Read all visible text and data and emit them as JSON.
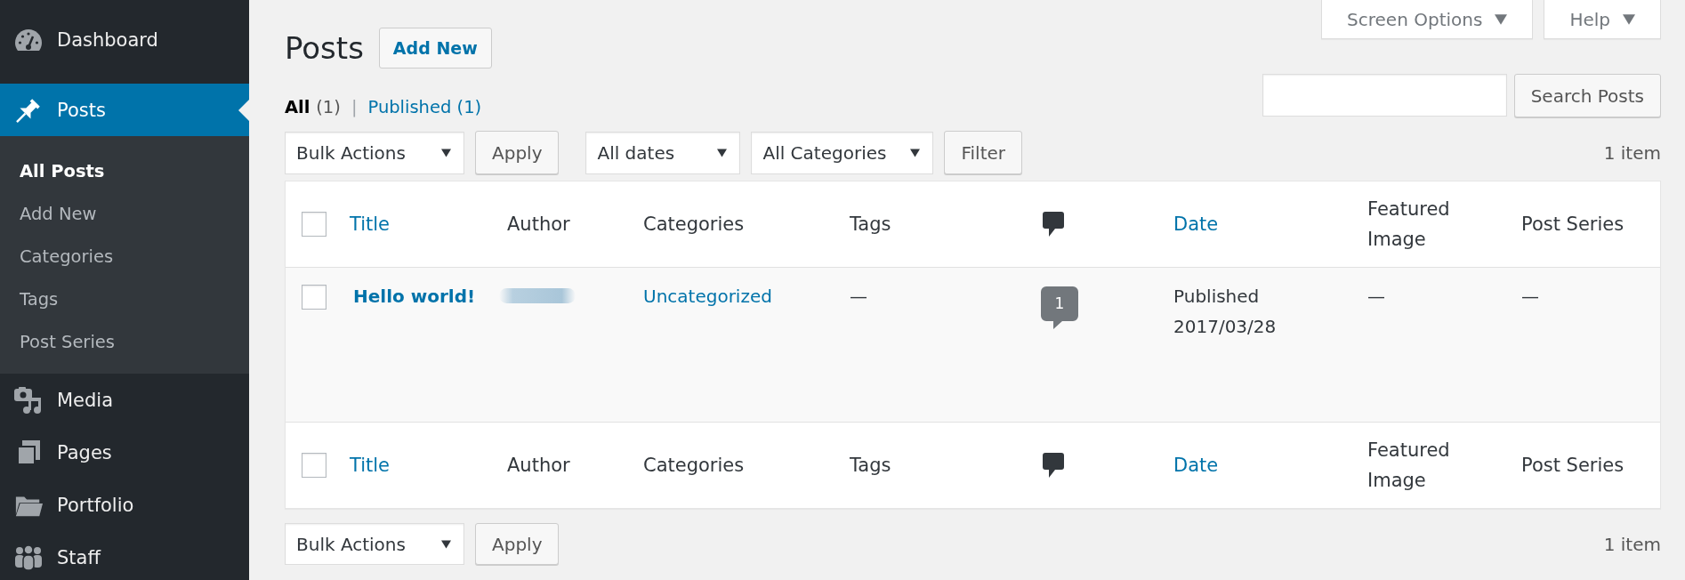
{
  "sidebar": {
    "items": [
      {
        "label": "Dashboard",
        "selected": false
      },
      {
        "label": "Posts",
        "selected": true,
        "children": [
          {
            "label": "All Posts",
            "selected": true
          },
          {
            "label": "Add New",
            "selected": false
          },
          {
            "label": "Categories",
            "selected": false
          },
          {
            "label": "Tags",
            "selected": false
          },
          {
            "label": "Post Series",
            "selected": false
          }
        ]
      },
      {
        "label": "Media",
        "selected": false
      },
      {
        "label": "Pages",
        "selected": false
      },
      {
        "label": "Portfolio",
        "selected": false
      },
      {
        "label": "Staff",
        "selected": false
      }
    ]
  },
  "screen_meta": {
    "tabs": [
      {
        "label": "Screen Options"
      },
      {
        "label": "Help"
      }
    ]
  },
  "header": {
    "title": "Posts",
    "add_new_button": "Add New"
  },
  "views": {
    "items": [
      {
        "label": "All",
        "count": "(1)",
        "selected": true
      },
      {
        "label": "Published",
        "count": "(1)",
        "selected": false
      }
    ],
    "separator": "|"
  },
  "search": {
    "button": "Search Posts"
  },
  "top_toolbar": {
    "bulk_action": "Bulk Actions",
    "apply_button": "Apply",
    "filters": [
      "All dates",
      "All Categories"
    ],
    "filter_button": "Filter",
    "item_count": "1 item"
  },
  "table": {
    "columns": [
      {
        "kind": "checkbox",
        "checked": false
      },
      {
        "kind": "text",
        "label": "Title",
        "sortable": true
      },
      {
        "kind": "text",
        "label": "Author",
        "sortable": false
      },
      {
        "kind": "text",
        "label": "Categories",
        "sortable": false
      },
      {
        "kind": "text",
        "label": "Tags",
        "sortable": false
      },
      {
        "kind": "comments"
      },
      {
        "kind": "text",
        "label": "Date",
        "sortable": true
      },
      {
        "kind": "text",
        "label": "Featured Image",
        "sortable": false
      },
      {
        "kind": "text",
        "label": "Post Series",
        "sortable": false
      }
    ],
    "rows": [
      {
        "checked": false,
        "title": "Hello world!",
        "author_blurred": true,
        "categories": "Uncategorized",
        "tags": "—",
        "comments": "1",
        "date_status": "Published",
        "date": "2017/03/28",
        "featured_image": "—",
        "post_series": "—"
      }
    ],
    "footer_columns": [
      {
        "kind": "checkbox",
        "checked": false
      },
      {
        "kind": "text",
        "label": "Title",
        "sortable": true
      },
      {
        "kind": "text",
        "label": "Author",
        "sortable": false
      },
      {
        "kind": "text",
        "label": "Categories",
        "sortable": false
      },
      {
        "kind": "text",
        "label": "Tags",
        "sortable": false
      },
      {
        "kind": "comments"
      },
      {
        "kind": "text",
        "label": "Date",
        "sortable": true
      },
      {
        "kind": "text",
        "label": "Featured Image",
        "sortable": false
      },
      {
        "kind": "text",
        "label": "Post Series",
        "sortable": false
      }
    ]
  },
  "bottom_toolbar": {
    "bulk_action": "Bulk Actions",
    "apply_button": "Apply",
    "item_count": "1 item"
  }
}
